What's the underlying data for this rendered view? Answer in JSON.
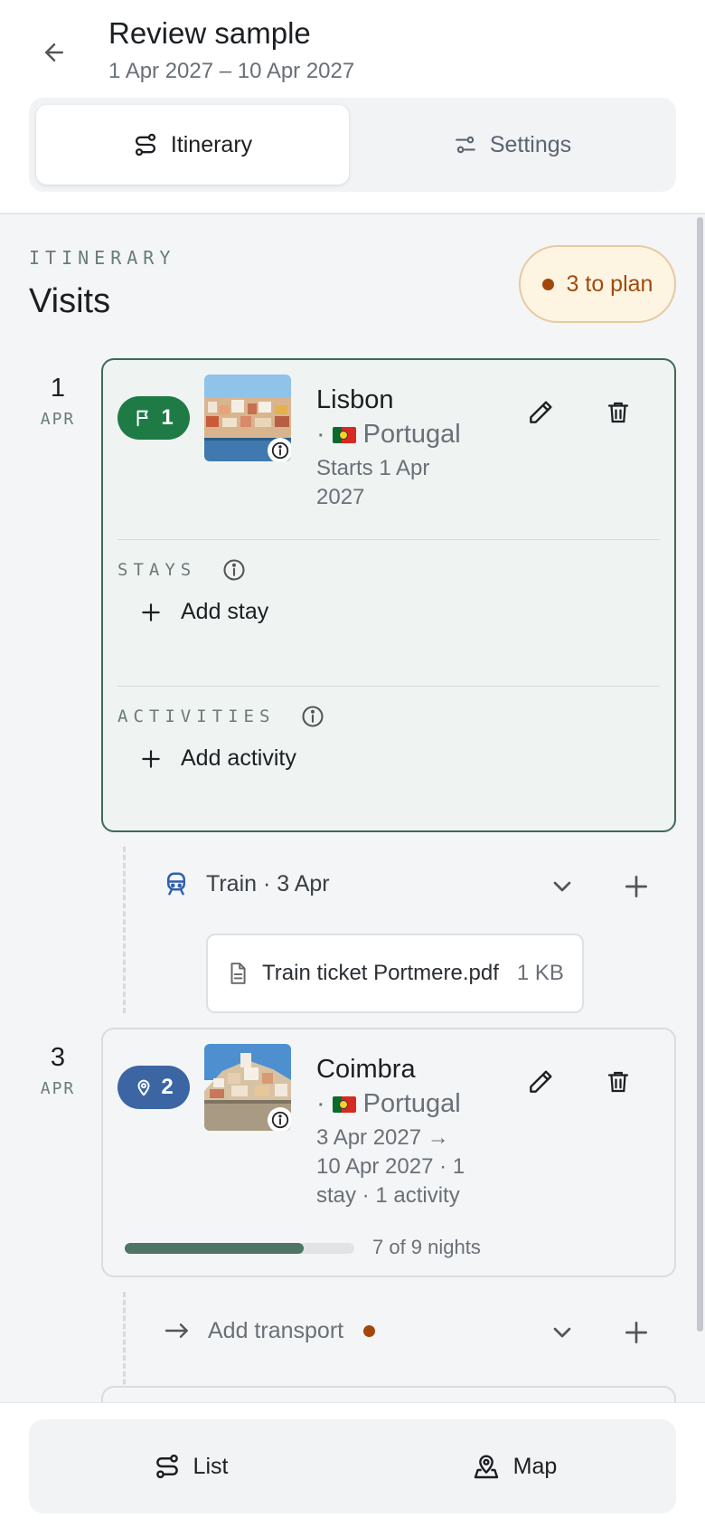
{
  "header": {
    "title": "Review sample",
    "dates": "1 Apr 2027 – 10 Apr 2027",
    "tabs": [
      {
        "label": "Itinerary",
        "icon": "route-icon",
        "active": true
      },
      {
        "label": "Settings",
        "icon": "sliders-icon",
        "active": false
      }
    ]
  },
  "section": {
    "label": "ITINERARY",
    "title": "Visits",
    "to_plan": "3 to plan"
  },
  "visits": [
    {
      "day": "1",
      "month": "APR",
      "badge": "1",
      "badge_icon": "flag-icon",
      "city": "Lisbon",
      "country": "Portugal",
      "subtitle": "Starts 1 Apr 2027",
      "stays_label": "STAYS",
      "add_stay": "Add stay",
      "activities_label": "ACTIVITIES",
      "add_activity": "Add activity"
    },
    {
      "day": "3",
      "month": "APR",
      "badge": "2",
      "badge_icon": "map-pin-icon",
      "city": "Coimbra",
      "country": "Portugal",
      "subtitle": "3 Apr 2027 → 10 Apr 2027 · 1 stay · 1 activity",
      "progress": 0.78,
      "nights": "7 of 9 nights"
    }
  ],
  "transports": [
    {
      "label": "Train · 3 Apr",
      "icon": "train-icon",
      "file": {
        "name": "Train ticket Portmere.pdf",
        "size": "1 KB"
      }
    },
    {
      "label": "Add transport",
      "icon": "arrow-right-icon"
    }
  ],
  "bottom_nav": [
    {
      "label": "List",
      "icon": "route-icon"
    },
    {
      "label": "Map",
      "icon": "map-pin-icon"
    }
  ],
  "colors": {
    "accent_green": "#1e7b45",
    "accent_blue": "#3b66a3",
    "warning": "#a5460c"
  }
}
